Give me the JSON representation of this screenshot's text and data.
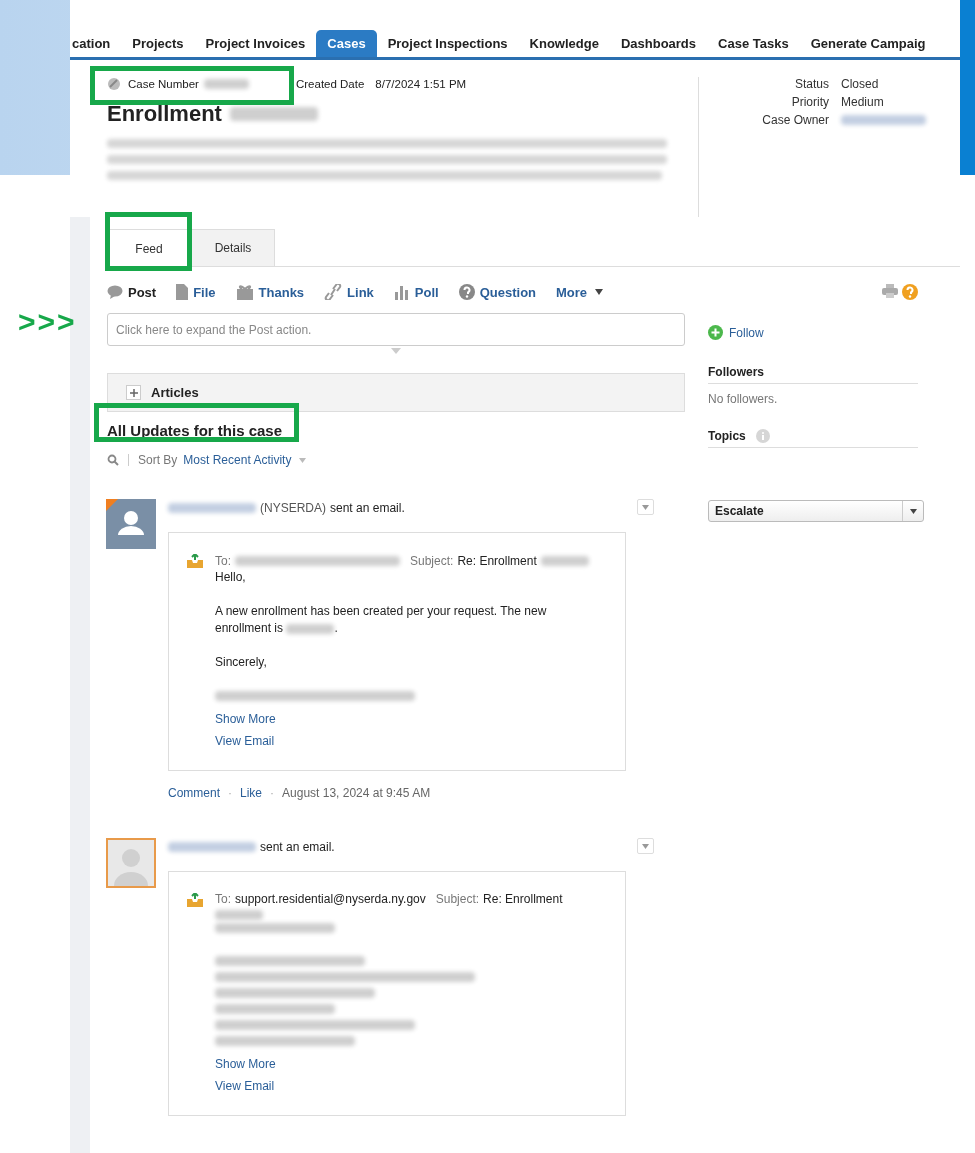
{
  "annotations": {
    "arrow": ">>>"
  },
  "nav_tabs": [
    {
      "label": "cation",
      "selected": false
    },
    {
      "label": "Projects",
      "selected": false
    },
    {
      "label": "Project Invoices",
      "selected": false
    },
    {
      "label": "Cases",
      "selected": true
    },
    {
      "label": "Project Inspections",
      "selected": false
    },
    {
      "label": "Knowledge",
      "selected": false
    },
    {
      "label": "Dashboards",
      "selected": false
    },
    {
      "label": "Case Tasks",
      "selected": false
    },
    {
      "label": "Generate Campaig",
      "selected": false
    }
  ],
  "header": {
    "case_number_label": "Case Number",
    "created_date_label": "Created Date",
    "created_date": "8/7/2024 1:51 PM",
    "title": "Enrollment",
    "fields": [
      {
        "label": "Status",
        "value": "Closed"
      },
      {
        "label": "Priority",
        "value": "Medium"
      },
      {
        "label": "Case Owner"
      }
    ]
  },
  "feed_tabs": [
    {
      "label": "Feed",
      "selected": true
    },
    {
      "label": "Details",
      "selected": false
    }
  ],
  "publisher": {
    "actions": [
      {
        "label": "Post",
        "selected": true
      },
      {
        "label": "File",
        "selected": false
      },
      {
        "label": "Thanks",
        "selected": false
      },
      {
        "label": "Link",
        "selected": false
      },
      {
        "label": "Poll",
        "selected": false
      },
      {
        "label": "Question",
        "selected": false
      }
    ],
    "more": "More",
    "placeholder": "Click here to expand the Post action."
  },
  "articles": {
    "label": "Articles"
  },
  "feed_heading": "All Updates for this case",
  "sort": {
    "label": "Sort By",
    "value": "Most Recent Activity"
  },
  "feed_items": [
    {
      "kind": "user",
      "actor_suffix": "(NYSERDA)",
      "action": "sent an email.",
      "email": {
        "to_label": "To:",
        "subject_label": "Subject:",
        "subject": "Re: Enrollment",
        "body": [
          {
            "kind": "text",
            "text": "Hello,"
          },
          {
            "kind": "gap"
          },
          {
            "kind": "text",
            "text": "A new enrollment has been created per your request. The new enrollment is",
            "tail": "."
          },
          {
            "kind": "gap"
          },
          {
            "kind": "text",
            "text": "Sincerely,"
          },
          {
            "kind": "gap"
          },
          {
            "kind": "redacted"
          }
        ],
        "links": [
          "Show More",
          "View Email"
        ]
      },
      "footer": {
        "comment": "Comment",
        "separator_1": "·",
        "like": "Like",
        "separator_2": "·",
        "time": "August 13, 2024 at 9:45 AM"
      }
    },
    {
      "kind": "default",
      "action": "sent an email.",
      "email": {
        "to_label": "To:",
        "to": "support.residential@nyserda.ny.gov",
        "subject_label": "Subject:",
        "subject": "Re: Enrollment",
        "body": [
          {
            "kind": "redacted"
          },
          {
            "kind": "gap"
          },
          {
            "kind": "redacted"
          },
          {
            "kind": "redacted"
          },
          {
            "kind": "redacted"
          },
          {
            "kind": "redacted"
          },
          {
            "kind": "redacted"
          },
          {
            "kind": "redacted"
          }
        ],
        "links": [
          "Show More",
          "View Email"
        ]
      }
    }
  ],
  "sidebar": {
    "follow": "Follow",
    "followers_heading": "Followers",
    "followers_empty": "No followers.",
    "topics_heading": "Topics",
    "action_select": "Escalate"
  }
}
